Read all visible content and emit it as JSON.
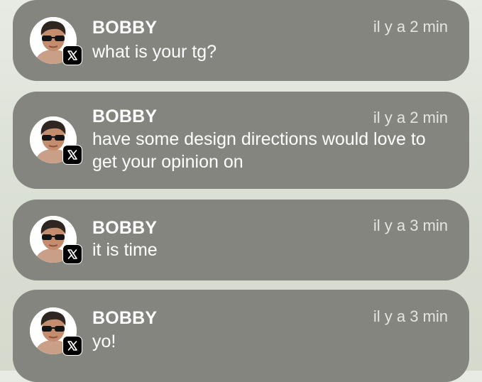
{
  "notifications": [
    {
      "sender": "BOBBY",
      "time": "il y a 2 min",
      "message": "what is your tg?",
      "app_icon": "x-logo-icon"
    },
    {
      "sender": "BOBBY",
      "time": "il y a 2 min",
      "message": "have some design directions would love to get your opinion on",
      "app_icon": "x-logo-icon"
    },
    {
      "sender": "BOBBY",
      "time": "il y a 3 min",
      "message": "it is time",
      "app_icon": "x-logo-icon"
    },
    {
      "sender": "BOBBY",
      "time": "il y a 3 min",
      "message": "yo!",
      "app_icon": "x-logo-icon"
    }
  ],
  "colors": {
    "card_background": "#83857e",
    "page_background": "#dde2d8",
    "text": "#ffffff",
    "time_text": "#e4e5e0",
    "badge": "#000000"
  }
}
